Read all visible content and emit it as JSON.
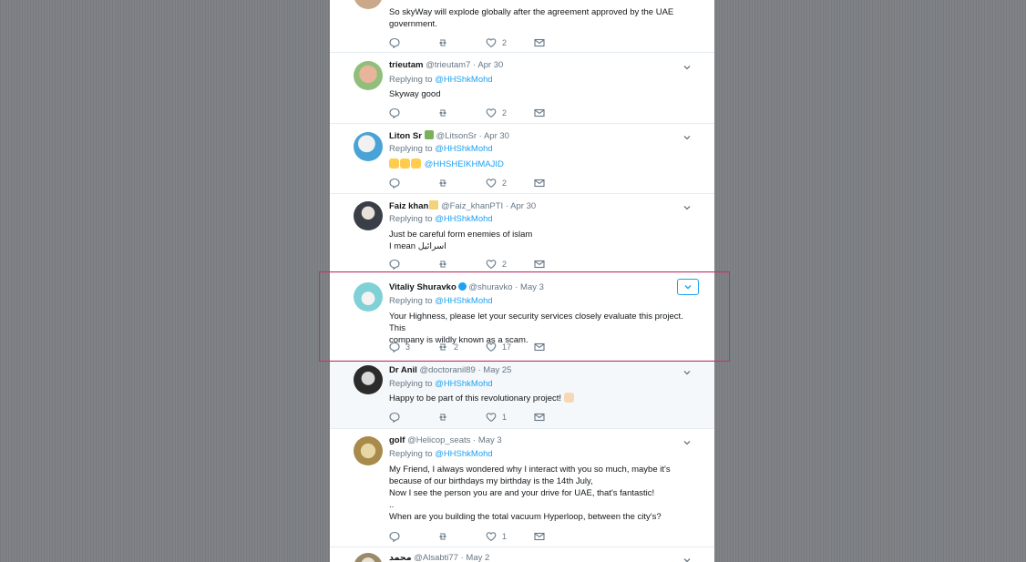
{
  "tweets": [
    {
      "id": "t0",
      "body": [
        "So skyWay will explode globally after the agreement approved by the UAE",
        "government."
      ],
      "stats": {
        "replies": "",
        "retweets": "",
        "likes": "2"
      }
    },
    {
      "id": "t1",
      "name": "trieutam",
      "handle": "@trieutam7",
      "date": "Apr 30",
      "replying_prefix": "Replying to",
      "replying_to": "@HHShkMohd",
      "body": [
        "Skyway good"
      ],
      "stats": {
        "replies": "",
        "retweets": "",
        "likes": "2"
      }
    },
    {
      "id": "t2",
      "name": "Liton Sr",
      "handle": "@LitsonSr",
      "date": "Apr 30",
      "replying_prefix": "Replying to",
      "replying_to": "@HHShkMohd",
      "mention": "@HHSHEIKHMAJID",
      "stats": {
        "replies": "",
        "retweets": "",
        "likes": "2"
      }
    },
    {
      "id": "t3",
      "name": "Faiz khan",
      "handle": "@Faiz_khanPTI",
      "date": "Apr 30",
      "replying_prefix": "Replying to",
      "replying_to": "@HHShkMohd",
      "body": [
        "Just be careful form enemies of islam",
        "I mean اسرائيل"
      ],
      "stats": {
        "replies": "",
        "retweets": "",
        "likes": "2"
      }
    },
    {
      "id": "t4",
      "name": "Vitaliy Shuravko",
      "handle": "@shuravko",
      "date": "May 3",
      "replying_prefix": "Replying to",
      "replying_to": "@HHShkMohd",
      "body": [
        "Your Highness, please let your security services closely evaluate this project. This",
        "company is wildly known as a scam."
      ],
      "stats": {
        "replies": "3",
        "retweets": "2",
        "likes": "17"
      }
    },
    {
      "id": "t5",
      "name": "Dr Anil",
      "handle": "@doctoranil89",
      "date": "May 25",
      "replying_prefix": "Replying to",
      "replying_to": "@HHShkMohd",
      "body": [
        "Happy to be part of this revolutionary project!"
      ],
      "stats": {
        "replies": "",
        "retweets": "",
        "likes": "1"
      }
    },
    {
      "id": "t6",
      "name": "golf",
      "handle": "@Helicop_seats",
      "date": "May 3",
      "replying_prefix": "Replying to",
      "replying_to": "@HHShkMohd",
      "body": [
        "My Friend, I always wondered why I interact with you so much, maybe it's",
        "because of our birthdays my birthday is the 14th July,",
        "Now I see the person you are and your drive for UAE, that's fantastic!",
        "..",
        "When are you building the total vacuum Hyperloop, between the city's?"
      ],
      "stats": {
        "replies": "",
        "retweets": "",
        "likes": "1"
      }
    },
    {
      "id": "t7",
      "name": "محمد",
      "handle": "@Alsabti77",
      "date": "May 2"
    }
  ],
  "dot": "·",
  "colors": {
    "link": "#1da1f2",
    "text": "#14171a",
    "muted": "#657786",
    "highlight_border": "#e0245e"
  }
}
